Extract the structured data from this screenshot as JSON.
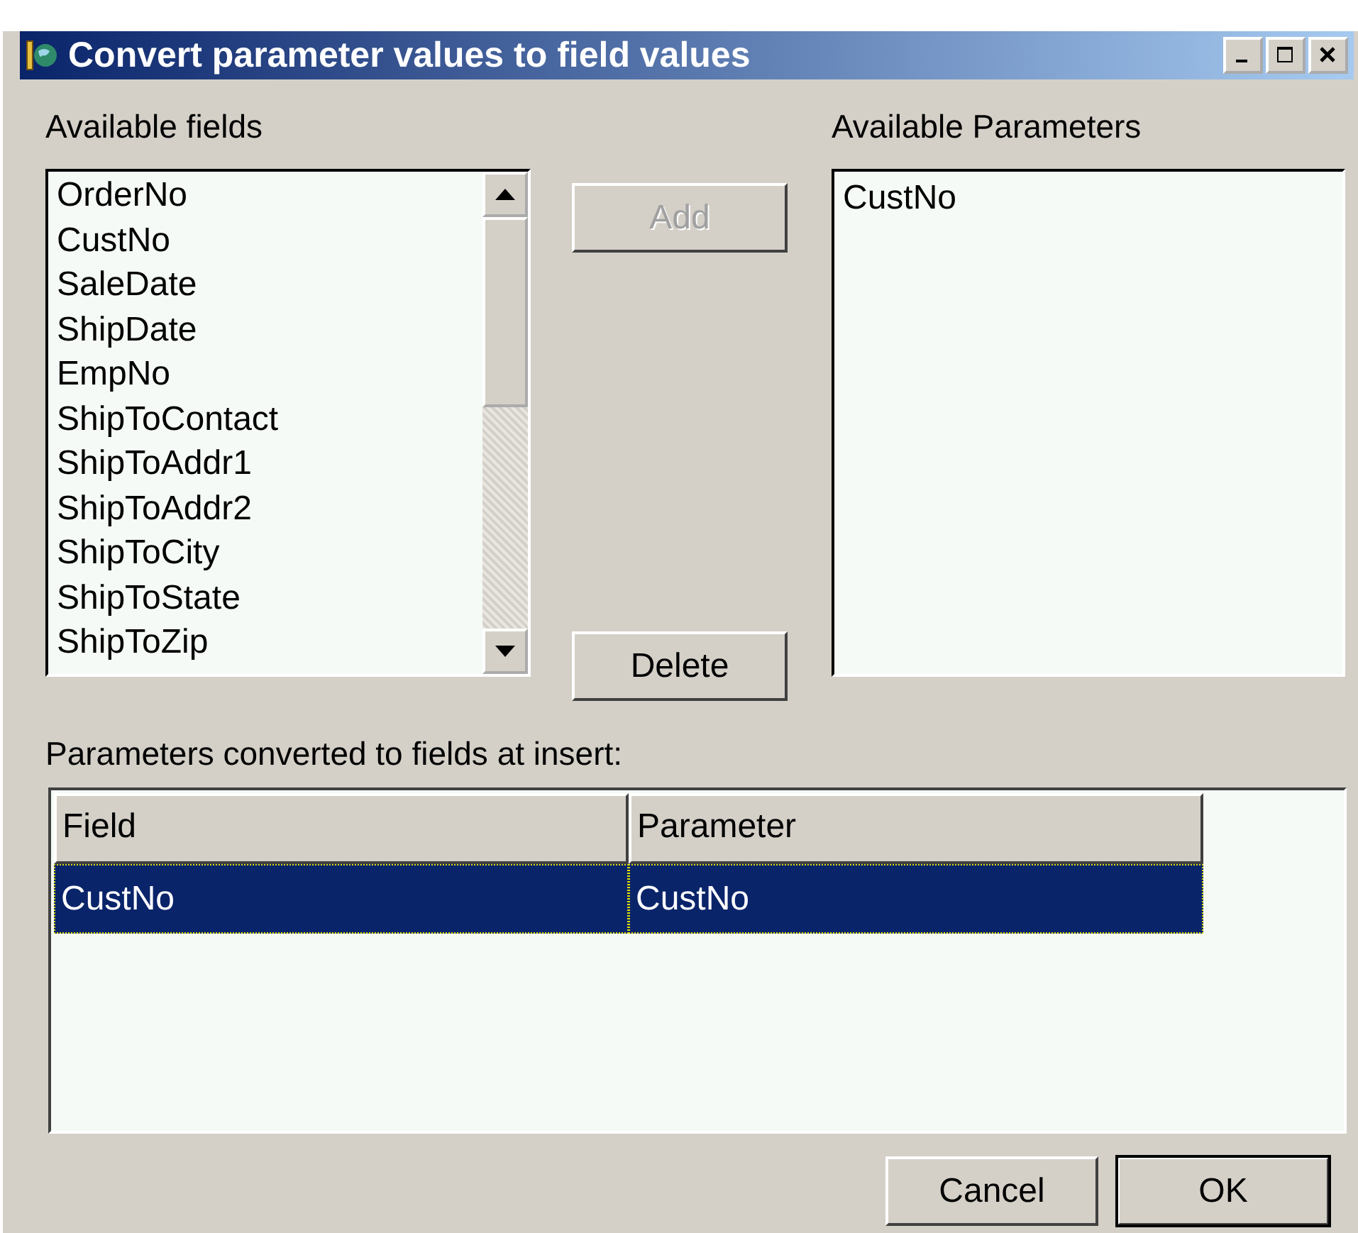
{
  "window": {
    "title": "Convert parameter values to field values"
  },
  "available_fields": {
    "label": "Available fields",
    "items": [
      "OrderNo",
      "CustNo",
      "SaleDate",
      "ShipDate",
      "EmpNo",
      "ShipToContact",
      "ShipToAddr1",
      "ShipToAddr2",
      "ShipToCity",
      "ShipToState",
      "ShipToZip"
    ]
  },
  "add_button": {
    "label": "Add",
    "disabled": true
  },
  "delete_button": {
    "label": "Delete",
    "disabled": false
  },
  "available_parameters": {
    "label": "Available Parameters",
    "items": [
      "CustNo"
    ]
  },
  "conversions": {
    "label": "Parameters converted to fields at insert:",
    "columns": [
      "Field",
      "Parameter"
    ],
    "rows": [
      {
        "cells": [
          "CustNo",
          "CustNo"
        ],
        "selected": true
      }
    ]
  },
  "buttons": [
    {
      "label": "Cancel",
      "default": false
    },
    {
      "label": "OK",
      "default": true
    }
  ]
}
